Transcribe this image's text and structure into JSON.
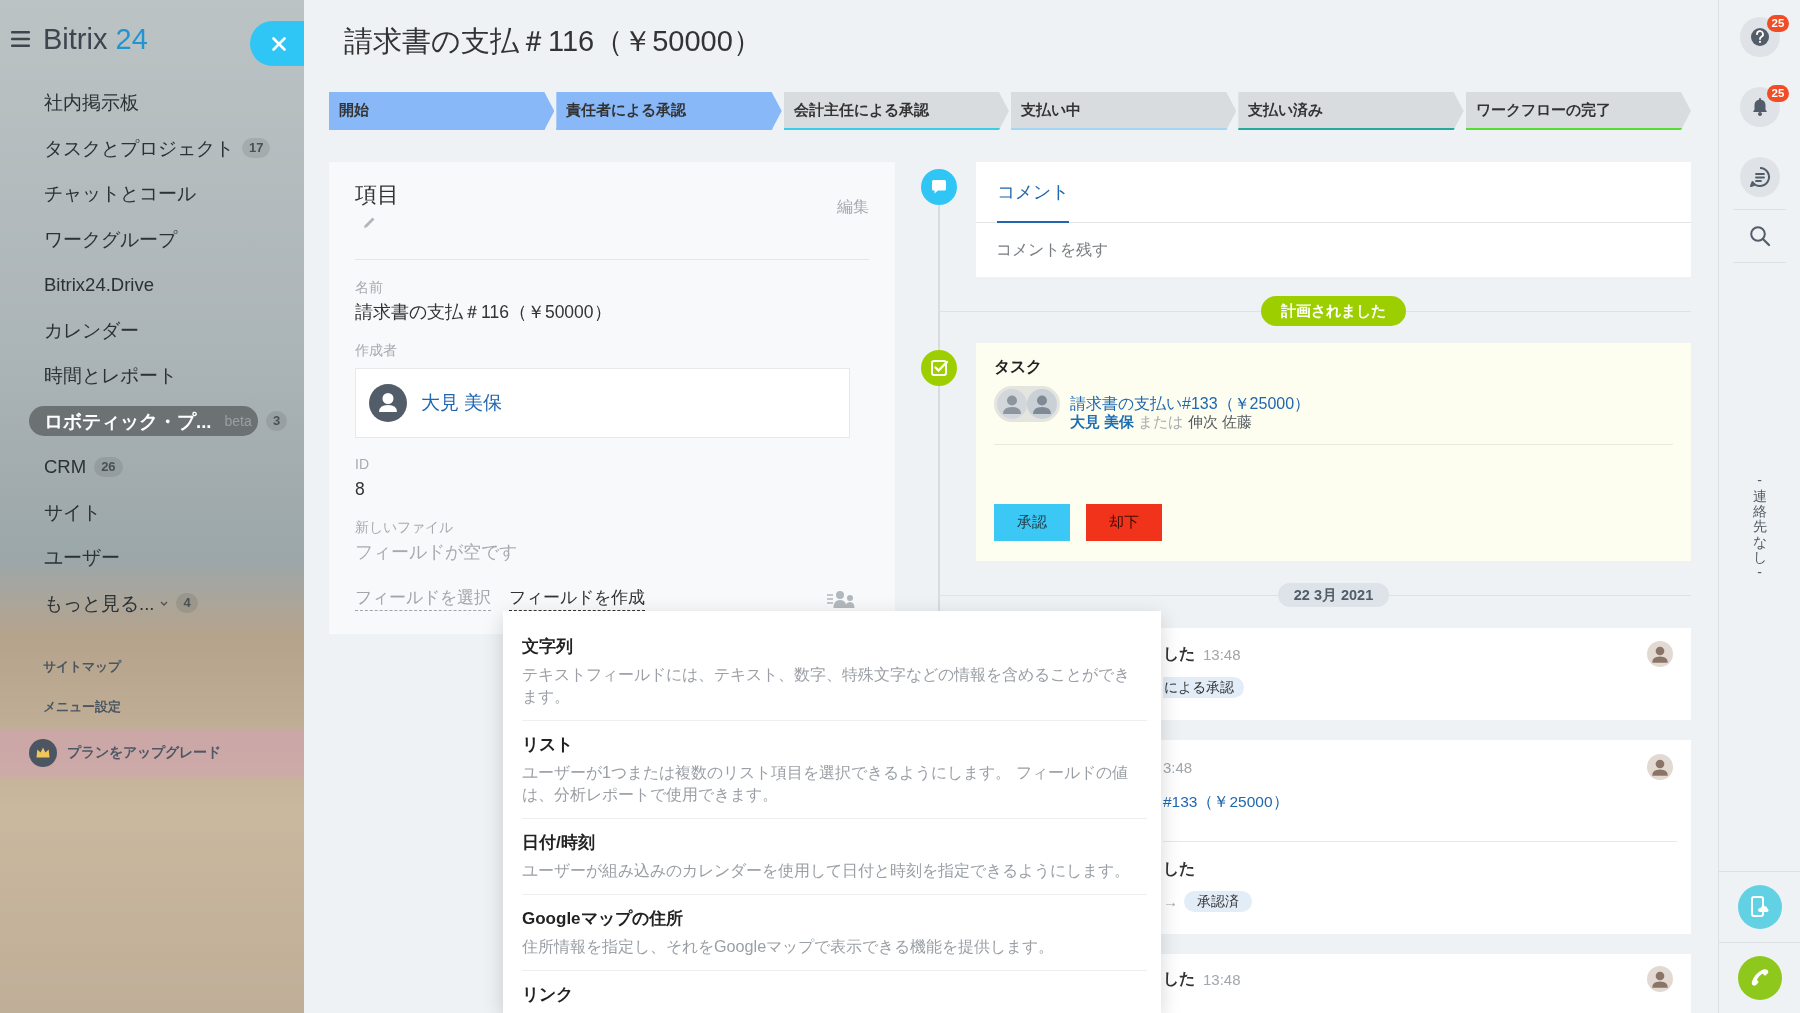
{
  "sidebar": {
    "logo": {
      "name": "Bitrix",
      "number": "24"
    },
    "items": [
      {
        "label": "社内掲示板",
        "selected": false
      },
      {
        "label": "タスクとプロジェクト",
        "counter": "17",
        "selected": false
      },
      {
        "label": "チャットとコール",
        "selected": false
      },
      {
        "label": "ワークグループ",
        "selected": false
      },
      {
        "label": "Bitrix24.Drive",
        "selected": false
      },
      {
        "label": "カレンダー",
        "selected": false
      },
      {
        "label": "時間とレポート",
        "selected": false
      },
      {
        "label": "ロボティック・プ...",
        "tag": "beta",
        "counter": "3",
        "selected": true
      },
      {
        "label": "CRM",
        "counter": "26",
        "selected": false
      },
      {
        "label": "サイト",
        "selected": false
      },
      {
        "label": "ユーザー",
        "selected": false
      }
    ],
    "more": {
      "label": "もっと見る...",
      "counter": "4"
    },
    "links": [
      "サイトマップ",
      "メニュー設定"
    ],
    "upgrade": "プランをアップグレード"
  },
  "title": "請求書の支払＃116（￥50000）",
  "stages": [
    {
      "label": "開始",
      "color": "#88b8f7",
      "passed": true
    },
    {
      "label": "責任者による承認",
      "color": "#88b8f7",
      "passed": true
    },
    {
      "label": "会計主任による承認",
      "color": "#3ccde6",
      "passed": false
    },
    {
      "label": "支払い中",
      "color": "#a3d6f5",
      "passed": false
    },
    {
      "label": "支払い済み",
      "color": "#25a99c",
      "passed": false
    },
    {
      "label": "ワークフローの完了",
      "color": "#55dc35",
      "passed": false
    }
  ],
  "details": {
    "title": "項目",
    "edit": "編集",
    "fields": [
      {
        "kind": "text",
        "label": "名前",
        "value": "請求書の支払＃116（￥50000）"
      },
      {
        "kind": "user",
        "label": "作成者",
        "value": "大見 美保"
      },
      {
        "kind": "text",
        "label": "ID",
        "value": "8"
      },
      {
        "kind": "empty",
        "label": "新しいファイル",
        "value": "フィールドが空です"
      }
    ],
    "links": [
      {
        "label": "フィールドを選択",
        "expanded": false
      },
      {
        "label": "フィールドを作成",
        "expanded": true
      }
    ]
  },
  "field_menu": {
    "items": [
      {
        "title": "文字列",
        "description": "テキストフィールドには、テキスト、数字、特殊文字などの情報を含めることができます。"
      },
      {
        "title": "リスト",
        "description": "ユーザーが1つまたは複数のリスト項目を選択できるようにします。 フィールドの値は、分析レポートで使用できます。"
      },
      {
        "title": "日付/時刻",
        "description": "ユーザーが組み込みのカレンダーを使用して日付と時刻を指定できるようにします。"
      },
      {
        "title": "Googleマップの住所",
        "description": "住所情報を指定し、それをGoogleマップで表示できる機能を提供します。"
      },
      {
        "title": "リンク"
      }
    ]
  },
  "timeline": {
    "comment": {
      "tab": {
        "label": "コメント",
        "selected": true
      },
      "placeholder": "コメントを残す"
    },
    "status": "計画されました",
    "task": {
      "heading": "タスク",
      "link": "請求書の支払い#133（￥25000）",
      "assignee": "大見 美保",
      "conjunction": "または",
      "alternate": "伸次 佐藤",
      "buttons": [
        {
          "kind": "approve",
          "label": "承認"
        },
        {
          "kind": "reject",
          "label": "却下"
        }
      ]
    },
    "date": "22 3月 2021",
    "history": [
      {
        "kind": "event",
        "title": "した",
        "time": "13:48",
        "tag": "による承認"
      },
      {
        "kind": "task",
        "time": "3:48",
        "link": "#133（￥25000）",
        "title": "した",
        "arrow": "→",
        "tag": "承認済"
      },
      {
        "kind": "event",
        "title": "した",
        "time": "13:48"
      }
    ]
  },
  "rail": {
    "buttons": [
      {
        "kind": "help",
        "badge": "25"
      },
      {
        "kind": "bell",
        "badge": "25"
      },
      {
        "kind": "chat"
      }
    ],
    "contacts": "- 連絡先なし -"
  }
}
